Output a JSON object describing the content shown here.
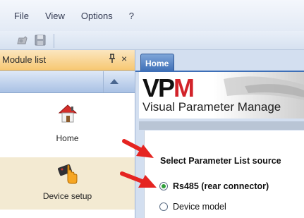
{
  "menu": {
    "items": [
      "File",
      "View",
      "Options",
      "?"
    ]
  },
  "toolbar": {
    "buttons": [
      "open-icon",
      "save-icon"
    ]
  },
  "module_list": {
    "title": "Module list",
    "pin_glyph": "ᵖ",
    "close_glyph": "×",
    "items": [
      {
        "label": "Home",
        "icon": "home-icon"
      },
      {
        "label": "Device setup",
        "icon": "device-setup-icon"
      }
    ]
  },
  "tab": {
    "label": "Home"
  },
  "banner": {
    "logo_v": "VP",
    "logo_m": "M",
    "subtitle": "Visual Parameter Manage"
  },
  "content": {
    "title": "Select Parameter List source",
    "options": [
      {
        "label": "Rs485 (rear connector)",
        "selected": true
      },
      {
        "label": "Device model",
        "selected": false
      }
    ]
  },
  "colors": {
    "accent_red": "#e52421",
    "tab_blue": "#3e6fb7",
    "panel_orange": "#f7c873",
    "radio_green": "#2f9e3a"
  }
}
